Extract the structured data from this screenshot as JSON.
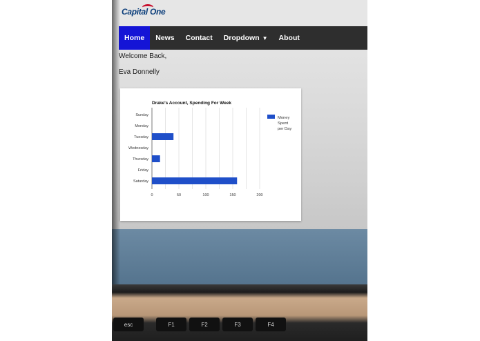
{
  "brand": {
    "logo_text": "Capital One"
  },
  "nav": {
    "items": [
      {
        "label": "Home",
        "active": true
      },
      {
        "label": "News",
        "active": false
      },
      {
        "label": "Contact",
        "active": false
      },
      {
        "label": "Dropdown",
        "active": false,
        "has_caret": true
      },
      {
        "label": "About",
        "active": false
      }
    ]
  },
  "greeting": {
    "line1": "Welcome Back,",
    "line2": "Eva Donnelly"
  },
  "colors": {
    "nav_bg": "#2e2e2e",
    "nav_active": "#1414d6",
    "bar": "#1f4fc9"
  },
  "keyboard": {
    "esc": "esc",
    "f1": "F1",
    "f2": "F2",
    "f3": "F3",
    "f4": "F4"
  },
  "chart_data": {
    "type": "bar",
    "orientation": "horizontal",
    "title": "Drake's Account, Spending For Week",
    "categories": [
      "Sunday",
      "Monday",
      "Tuesday",
      "Wednesday",
      "Thursday",
      "Friday",
      "Saturday"
    ],
    "series": [
      {
        "name": "Money Spent per Day",
        "values": [
          0,
          0,
          40,
          0,
          15,
          0,
          158
        ]
      }
    ],
    "legend": [
      "Money",
      "Spent",
      "per Day"
    ],
    "xticks": [
      "0",
      "50",
      "100",
      "150",
      "200"
    ],
    "xlim": [
      0,
      200
    ],
    "grid": true,
    "legend_position": "right"
  }
}
